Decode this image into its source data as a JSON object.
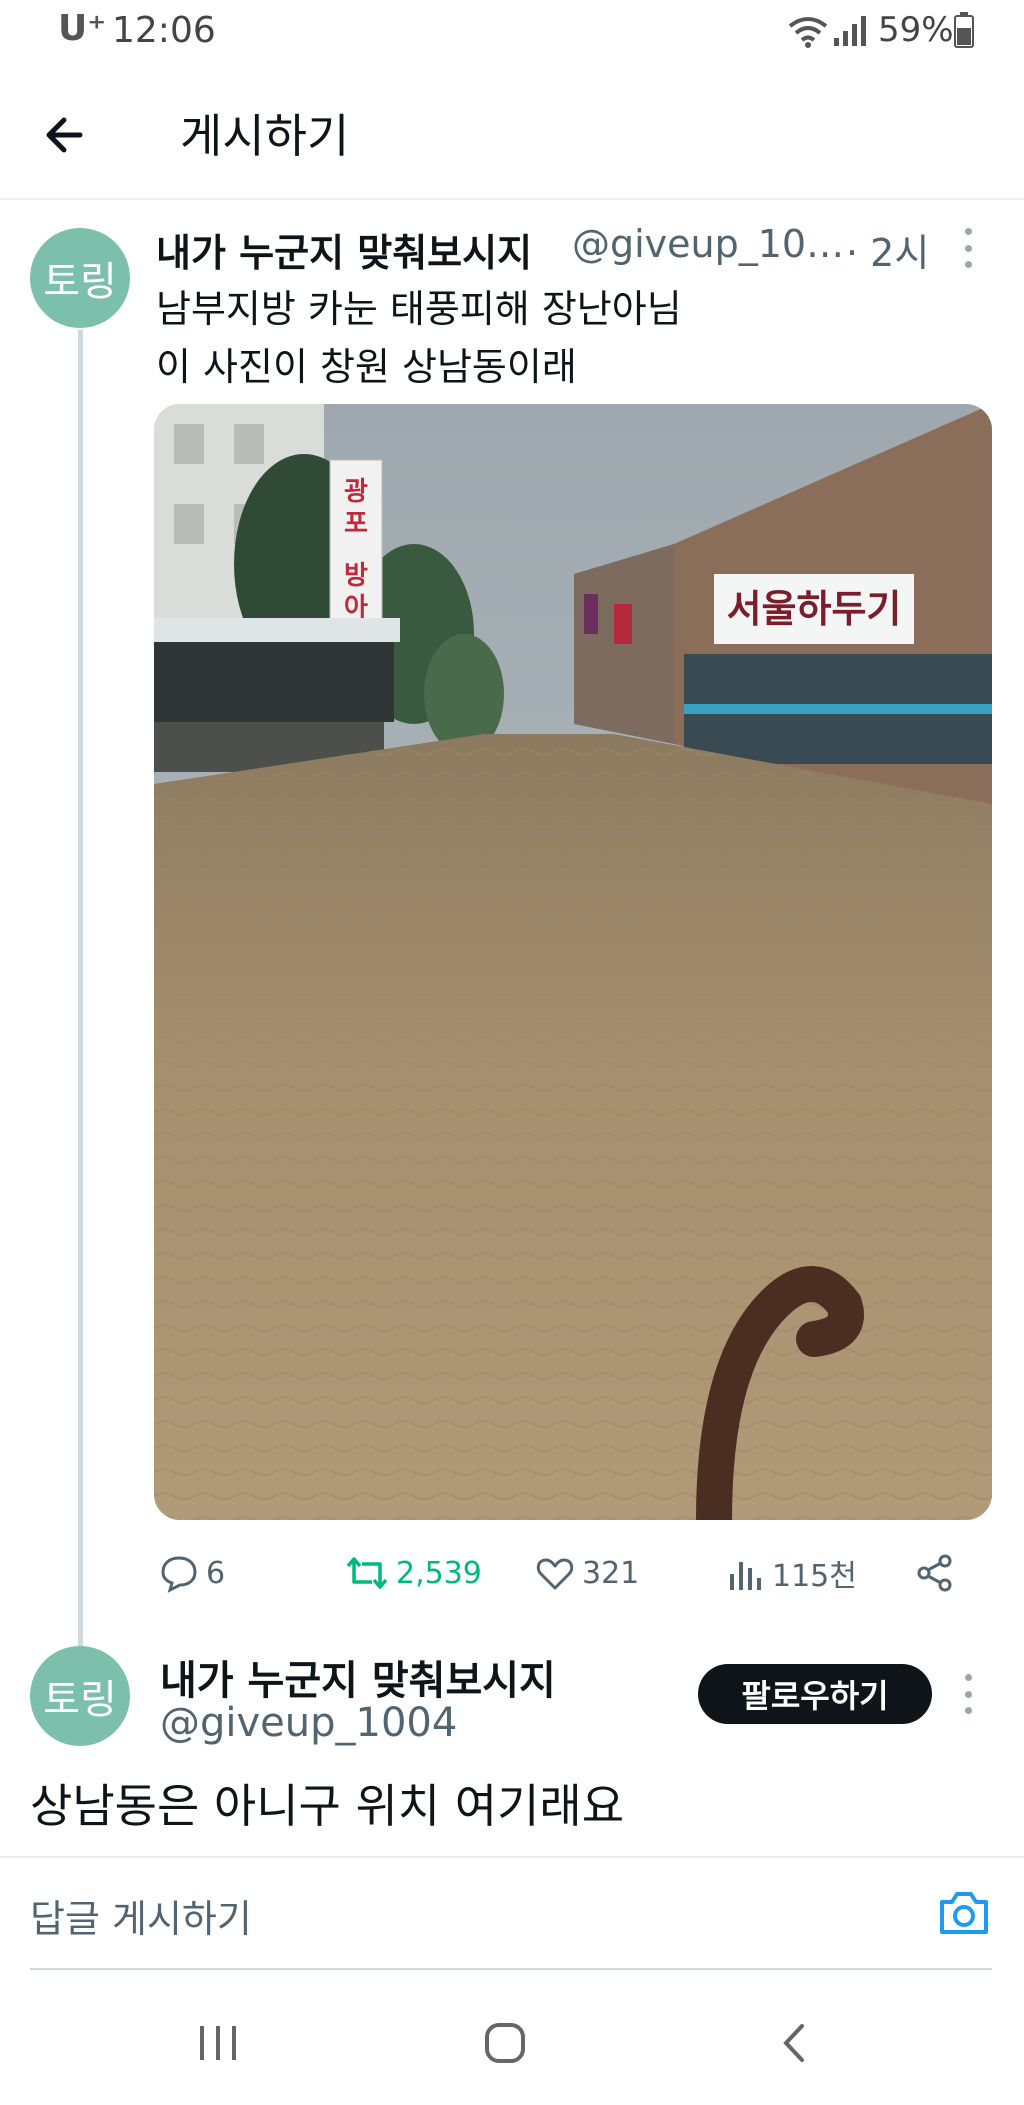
{
  "status_bar": {
    "carrier": "U⁺",
    "time": "12:06",
    "battery_percent": "59%",
    "icons": [
      "wifi-icon",
      "signal-icon",
      "battery-icon"
    ]
  },
  "header": {
    "back_icon": "arrow-left-icon",
    "title": "게시하기"
  },
  "tweet": {
    "avatar_text": "토링",
    "display_name": "내가 누군지 맞춰보시지",
    "handle": "@giveup_10…",
    "time": "· 2시",
    "text_lines": [
      "남부지방 카눈 태풍피해 장난아님",
      "이 사진이 창원 상남동이래"
    ],
    "photo": {
      "description_signs": [
        "광포",
        "방아",
        "서울하두기"
      ],
      "colors": {
        "water": "#a8926f",
        "sky": "#a9b3b8"
      }
    },
    "actions": {
      "replies": "6",
      "retweets": "2,539",
      "likes": "321",
      "views": "115천"
    }
  },
  "reply": {
    "avatar_text": "토링",
    "display_name": "내가 누군지 맞춰보시지",
    "handle": "@giveup_1004",
    "follow_label": "팔로우하기",
    "text": "상남동은 아니구 위치 여기래요"
  },
  "composer": {
    "placeholder": "답글 게시하기",
    "camera_icon": "camera-icon"
  },
  "navbar": {
    "icons": [
      "recent-apps-icon",
      "home-icon",
      "back-icon"
    ]
  },
  "colors": {
    "avatar_bg": "#7cc0ac",
    "retweet_green": "#00ba7c",
    "link_blue": "#1d9bf0",
    "follow_bg": "#0f1419"
  }
}
